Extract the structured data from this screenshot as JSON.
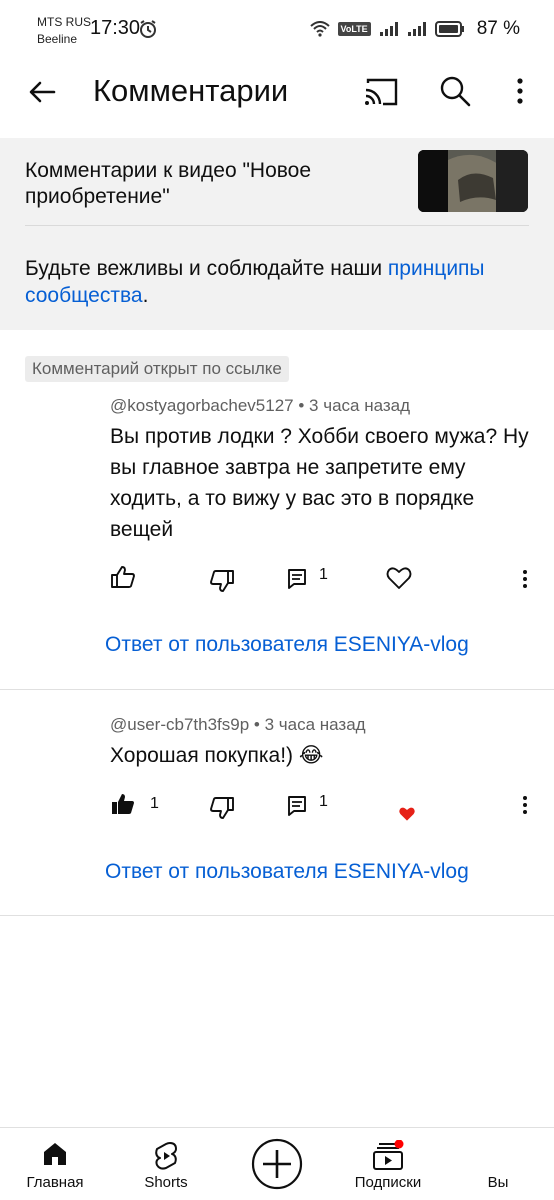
{
  "status_bar": {
    "carrier_1": "MTS RUS",
    "carrier_2": "Beeline",
    "time": "17:30",
    "volte": "VoLTE",
    "battery": "87 %"
  },
  "app_bar": {
    "title": "Комментарии",
    "icons": [
      "back-arrow-icon",
      "cast-icon",
      "search-icon",
      "more-vertical-icon"
    ]
  },
  "info_panel": {
    "video_title": "Комментарии к видео \"Новое приобретение\"",
    "guidelines_text": "Будьте вежливы и соблюдайте наши ",
    "guidelines_link": "принципы сообщества",
    "guidelines_end": "."
  },
  "linked_label": "Комментарий открыт по ссылке",
  "comments": [
    {
      "author": "@kostyagorbachev5127",
      "time": "3 часа назад",
      "text": "Вы против лодки ? Хобби своего мужа? Ну вы главное завтра не запретите ему ходить, а то вижу у вас это в порядке вещей",
      "likes": "",
      "replies": "1",
      "reply_label": "Ответ от пользователя ESENIYA-vlog"
    },
    {
      "author": "@user-cb7th3fs9p",
      "time": "3 часа назад",
      "text": "Хорошая покупка!) 😂",
      "likes": "1",
      "replies": "1",
      "reply_label": "Ответ от пользователя ESENIYA-vlog"
    }
  ],
  "bottom_nav": {
    "items": [
      {
        "label": "Главная",
        "icon": "home-icon"
      },
      {
        "label": "Shorts",
        "icon": "shorts-icon"
      },
      {
        "label": "",
        "icon": "create-icon"
      },
      {
        "label": "Подписки",
        "icon": "subscriptions-icon"
      },
      {
        "label": "Вы",
        "icon": "you-icon"
      }
    ]
  },
  "colors": {
    "link": "#065fd4",
    "heart": "#e62117",
    "panel_bg": "#f2f2f2",
    "notification_dot": "#ff0000"
  }
}
